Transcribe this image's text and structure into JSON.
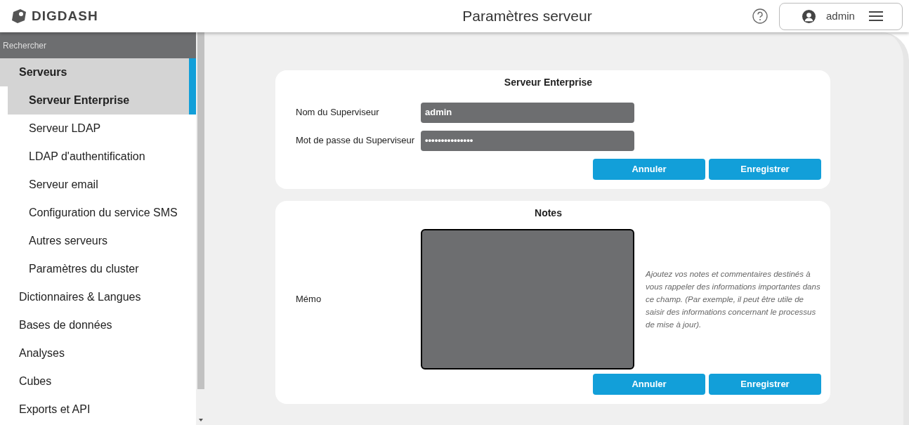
{
  "header": {
    "brand": "DIGDASH",
    "title": "Paramètres serveur",
    "user": "admin"
  },
  "sidebar": {
    "search_placeholder": "Rechercher",
    "items": [
      {
        "label": "Serveurs",
        "selected": true,
        "expanded": true,
        "children": [
          {
            "label": "Serveur Enterprise",
            "selected": true
          },
          {
            "label": "Serveur LDAP",
            "selected": false
          },
          {
            "label": "LDAP d'authentification",
            "selected": false
          },
          {
            "label": "Serveur email",
            "selected": false
          },
          {
            "label": "Configuration du service SMS",
            "selected": false
          },
          {
            "label": "Autres serveurs",
            "selected": false
          },
          {
            "label": "Paramètres du cluster",
            "selected": false
          }
        ]
      },
      {
        "label": "Dictionnaires & Langues",
        "selected": false
      },
      {
        "label": "Bases de données",
        "selected": false
      },
      {
        "label": "Analyses",
        "selected": false
      },
      {
        "label": "Cubes",
        "selected": false
      },
      {
        "label": "Exports et API",
        "selected": false
      }
    ]
  },
  "sections": [
    {
      "title": "Serveur Enterprise",
      "fields": [
        {
          "kind": "text",
          "label": "Nom du Superviseur",
          "value": "admin"
        },
        {
          "kind": "password",
          "label": "Mot de passe du Superviseur",
          "value": "•••••••••••••••"
        }
      ],
      "buttons": [
        "Annuler",
        "Enregistrer"
      ]
    },
    {
      "title": "Notes",
      "fields": [
        {
          "kind": "memo",
          "label": "Mémo",
          "help": "Ajoutez vos notes et commentaires destinés à vous rappeler des informations importantes dans ce champ. (Par exemple, il peut être utile de saisir des informations concernant le processus de mise à jour)."
        }
      ],
      "buttons": [
        "Annuler",
        "Enregistrer"
      ]
    }
  ]
}
